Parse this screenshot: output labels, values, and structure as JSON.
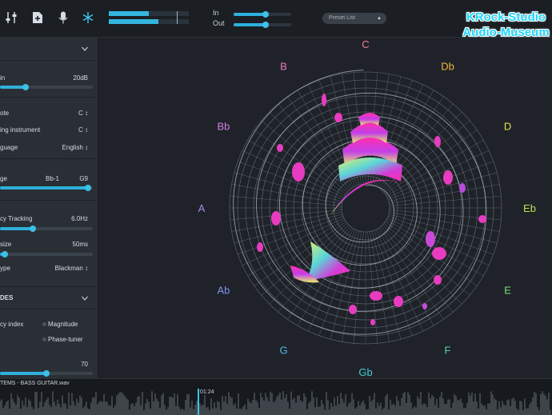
{
  "toolbar": {
    "icons": [
      "sliders-icon",
      "add-file-icon",
      "microphone-icon",
      "snowflake-icon"
    ],
    "io": {
      "in_label": "In",
      "out_label": "Out",
      "in_level": 0.55,
      "out_level": 0.55
    },
    "preset_label": "Preset List",
    "meter_levels": [
      0.5,
      0.62
    ]
  },
  "watermark": {
    "line1": "KRock-Studio",
    "line2": "Audio-Museum"
  },
  "panel": {
    "gain": {
      "label": "in",
      "value": "20dB",
      "level": 0.28
    },
    "root_note": {
      "label": "ote",
      "value": "C ↕"
    },
    "transposing": {
      "label": "ing instrument",
      "value": "C ↕"
    },
    "language": {
      "label": "guage",
      "value": "English ↕"
    },
    "range": {
      "label": "ge",
      "low": "Bb-1",
      "high": "G9",
      "level_start": 0.0,
      "level_end": 0.95
    },
    "freq_tracking": {
      "label": "cy Tracking",
      "value": "6.0Hz",
      "level": 0.35
    },
    "window_size": {
      "label": "size",
      "value": "50ms",
      "level": 0.05
    },
    "window_type": {
      "label": "ype",
      "value": "Blackman ↕"
    },
    "modes_title": "DES",
    "mode_label": "cy index",
    "mode_options": [
      "Magnitude",
      "Phase-tuner"
    ],
    "bottom": {
      "value": "70",
      "level": 0.5
    }
  },
  "notes": [
    {
      "name": "C",
      "color": "#f07a9a"
    },
    {
      "name": "Db",
      "color": "#f2b53a"
    },
    {
      "name": "D",
      "color": "#e7e24a"
    },
    {
      "name": "Eb",
      "color": "#b9e24d"
    },
    {
      "name": "E",
      "color": "#79e07a"
    },
    {
      "name": "F",
      "color": "#5ad6a8"
    },
    {
      "name": "Gb",
      "color": "#4cc9d8"
    },
    {
      "name": "G",
      "color": "#4fb6ee"
    },
    {
      "name": "Ab",
      "color": "#7f93f2"
    },
    {
      "name": "A",
      "color": "#ac82f0"
    },
    {
      "name": "Bb",
      "color": "#d77de6"
    },
    {
      "name": "B",
      "color": "#ee76c6"
    }
  ],
  "timeline": {
    "file": "TEMS - BASS GUITAR.wav",
    "time": "01:24"
  }
}
